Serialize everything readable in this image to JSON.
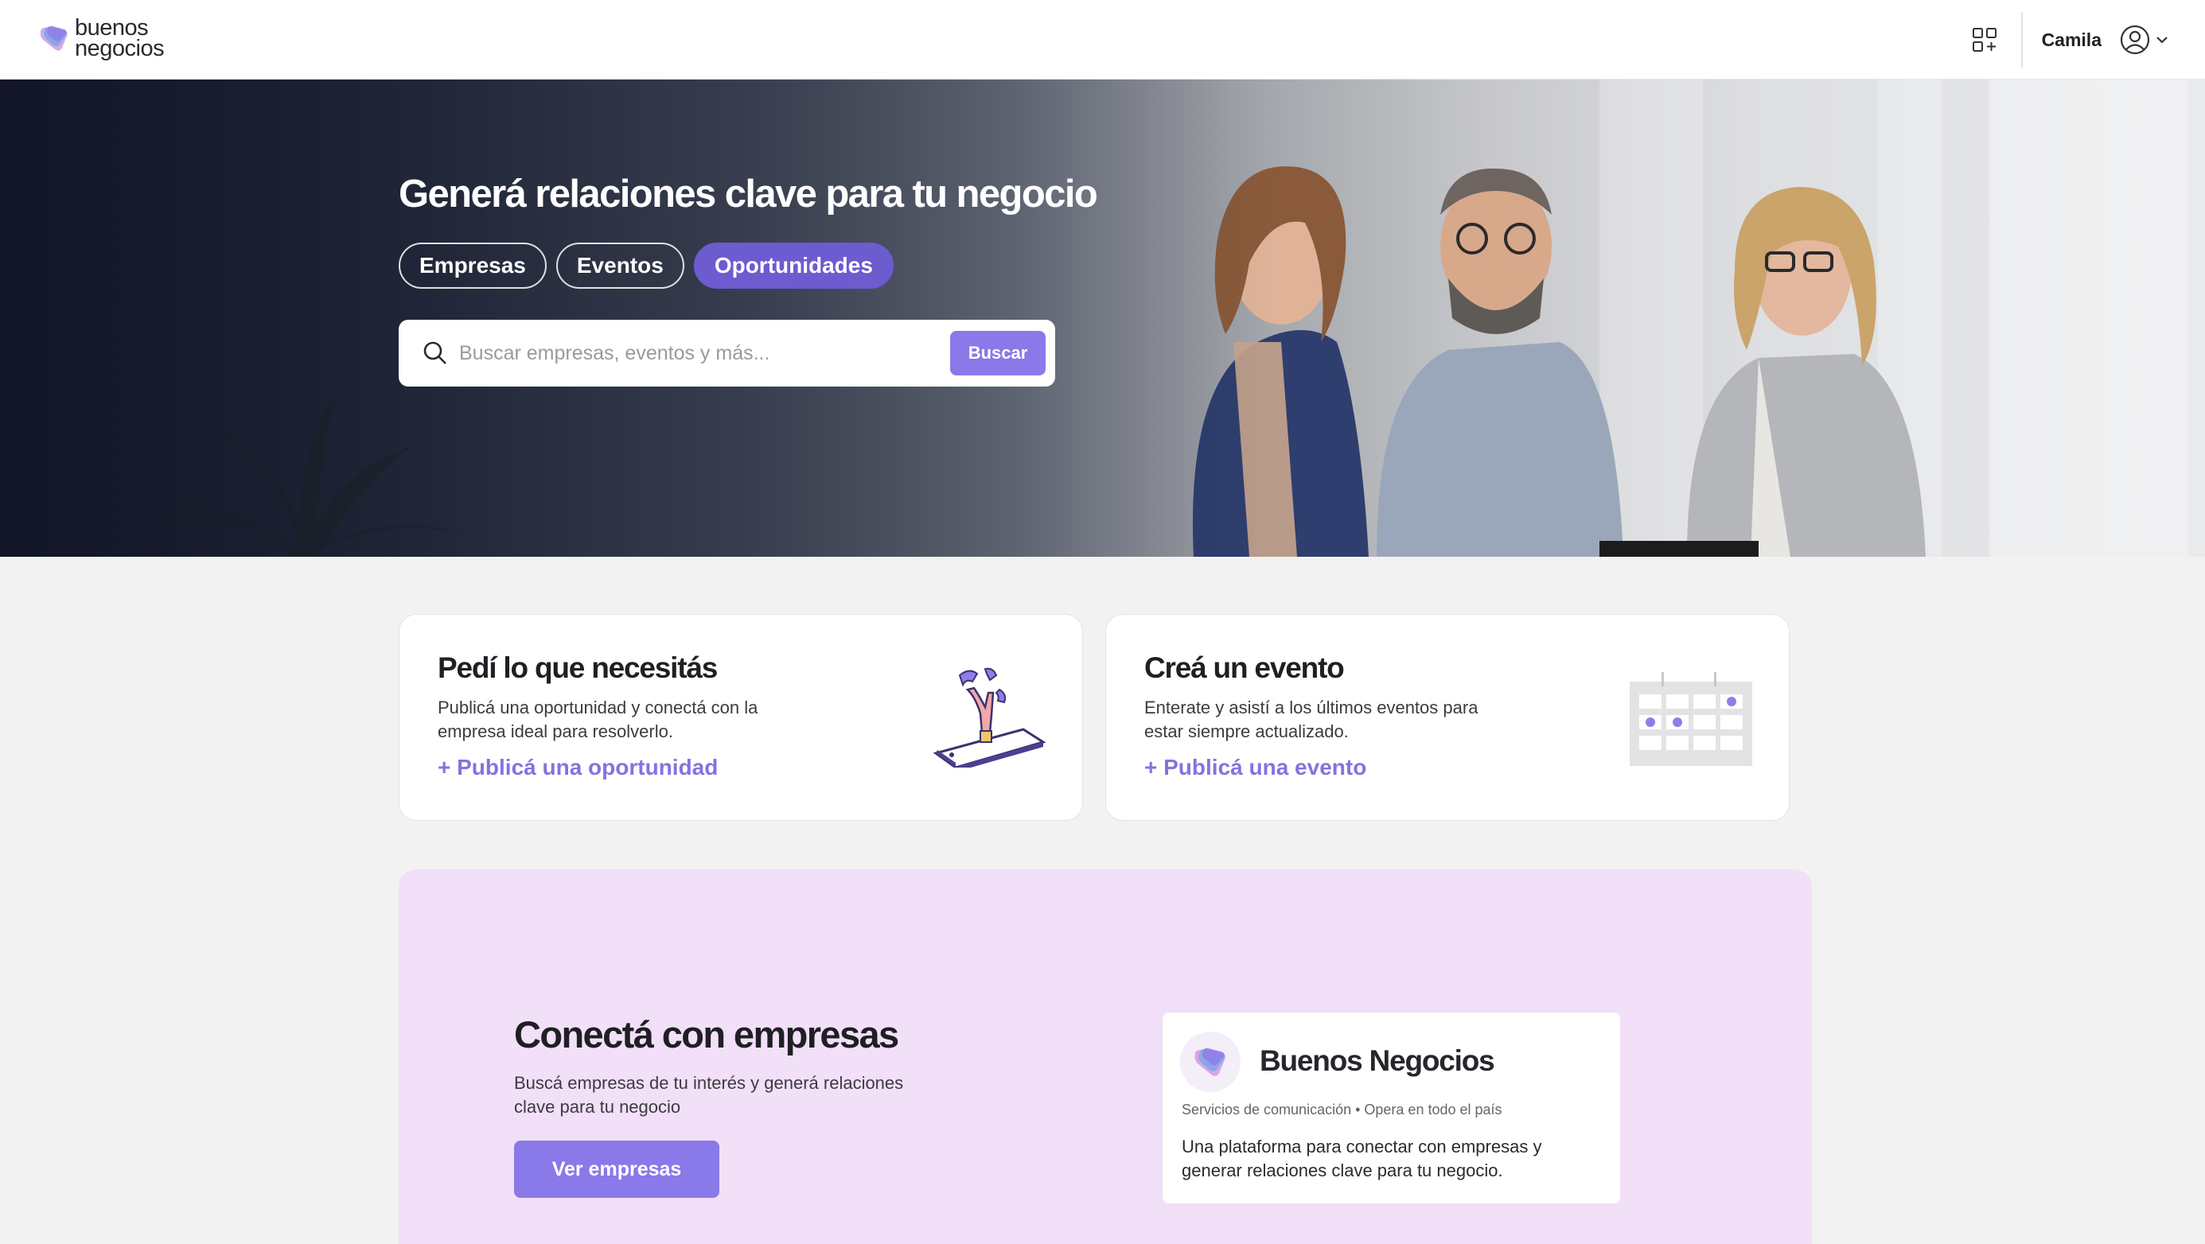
{
  "header": {
    "logo_line1": "buenos",
    "logo_line2": "negocios",
    "user_name": "Camila",
    "apps_icon": "apps-add-icon",
    "user_icon": "user-circle-icon"
  },
  "hero": {
    "title": "Generá relaciones clave para tu negocio",
    "tabs": [
      {
        "label": "Empresas",
        "active": false
      },
      {
        "label": "Eventos",
        "active": false
      },
      {
        "label": "Oportunidades",
        "active": true
      }
    ],
    "search": {
      "placeholder": "Buscar empresas, eventos y más...",
      "value": "",
      "button_label": "Buscar"
    }
  },
  "cards": [
    {
      "title": "Pedí lo que necesitás",
      "description": "Publicá una oportunidad y conectá con la empresa ideal para resolverlo.",
      "link": "+ Publicá una oportunidad",
      "illustration": "hand-phone-illustration"
    },
    {
      "title": "Creá un evento",
      "description": "Enterate y asistí a los últimos eventos para estar siempre actualizado.",
      "link": "+ Publicá una evento",
      "illustration": "calendar-illustration"
    }
  ],
  "connect": {
    "title": "Conectá con empresas",
    "description": "Buscá empresas de tu interés y generá relaciones clave para tu negocio",
    "button_label": "Ver empresas",
    "company": {
      "name": "Buenos Negocios",
      "meta": "Servicios de comunicación • Opera en todo el país",
      "description": "Una plataforma para conectar con empresas y generar relaciones clave para tu negocio."
    }
  },
  "colors": {
    "accent": "#8a79e8",
    "accent_dark": "#6d5bd0",
    "connect_bg": "#f2dff8",
    "page_bg": "#f2f2f2"
  }
}
